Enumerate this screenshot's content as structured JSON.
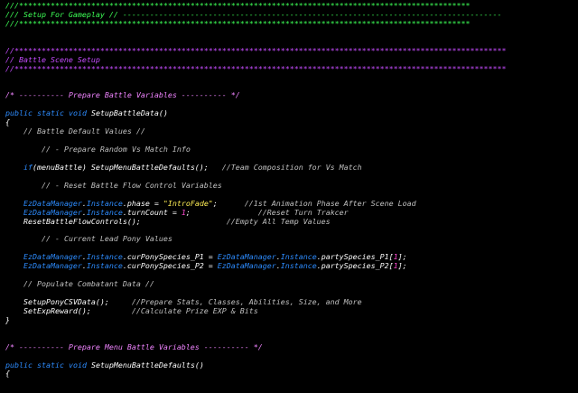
{
  "editor": {
    "colors": {
      "background": "#000000",
      "keyword": "#2d8cff",
      "comment": "#c0c0c0",
      "header_comment": "#3dff56",
      "section_comment": "#c64cff",
      "block_comment": "#f084ff",
      "string": "#ffee55",
      "number": "#ff4ad2",
      "text": "#ffffff"
    },
    "lines": [
      [
        {
          "t": "///****************************************************************************************************",
          "c": "gr"
        }
      ],
      [
        {
          "t": "/// Setup For Gameplay // ------------------------------------------------------------------------------------",
          "c": "gr"
        }
      ],
      [
        {
          "t": "///****************************************************************************************************",
          "c": "gr"
        }
      ],
      [],
      [],
      [
        {
          "t": "//*************************************************************************************************************",
          "c": "mg"
        }
      ],
      [
        {
          "t": "// Battle Scene Setup",
          "c": "mg"
        }
      ],
      [
        {
          "t": "//*************************************************************************************************************",
          "c": "mg"
        }
      ],
      [],
      [],
      [
        {
          "t": "/* ---------- Prepare Battle Variables ---------- */",
          "c": "pk"
        }
      ],
      [],
      [
        {
          "t": "public",
          "c": "kw"
        },
        {
          "t": " ",
          "c": "plain"
        },
        {
          "t": "static",
          "c": "kw"
        },
        {
          "t": " ",
          "c": "plain"
        },
        {
          "t": "void",
          "c": "kw"
        },
        {
          "t": " SetupBattleData()",
          "c": "plain"
        }
      ],
      [
        {
          "t": "{",
          "c": "plain"
        }
      ],
      [
        {
          "t": "    ",
          "c": "plain"
        },
        {
          "t": "// Battle Default Values //",
          "c": "cm"
        }
      ],
      [],
      [
        {
          "t": "        ",
          "c": "plain"
        },
        {
          "t": "// - Prepare Random Vs Match Info",
          "c": "cm"
        }
      ],
      [],
      [
        {
          "t": "    ",
          "c": "plain"
        },
        {
          "t": "if",
          "c": "kw"
        },
        {
          "t": "(menuBattle) SetupMenuBattleDefaults();   ",
          "c": "plain"
        },
        {
          "t": "//Team Composition for Vs Match",
          "c": "cm"
        }
      ],
      [],
      [
        {
          "t": "        ",
          "c": "plain"
        },
        {
          "t": "// - Reset Battle Flow Control Variables",
          "c": "cm"
        }
      ],
      [],
      [
        {
          "t": "    ",
          "c": "plain"
        },
        {
          "t": "EzDataManager",
          "c": "kw"
        },
        {
          "t": ".",
          "c": "plain"
        },
        {
          "t": "Instance",
          "c": "kw"
        },
        {
          "t": ".phase = ",
          "c": "plain"
        },
        {
          "t": "\"IntroFade\"",
          "c": "str"
        },
        {
          "t": ";      ",
          "c": "plain"
        },
        {
          "t": "//1st Animation Phase After Scene Load",
          "c": "cm"
        }
      ],
      [
        {
          "t": "    ",
          "c": "plain"
        },
        {
          "t": "EzDataManager",
          "c": "kw"
        },
        {
          "t": ".",
          "c": "plain"
        },
        {
          "t": "Instance",
          "c": "kw"
        },
        {
          "t": ".turnCount = ",
          "c": "plain"
        },
        {
          "t": "1",
          "c": "num"
        },
        {
          "t": ";               ",
          "c": "plain"
        },
        {
          "t": "//Reset Turn Trakcer",
          "c": "cm"
        }
      ],
      [
        {
          "t": "    ResetBattleFlowControls();                   ",
          "c": "plain"
        },
        {
          "t": "//Empty All Temp Values",
          "c": "cm"
        }
      ],
      [],
      [
        {
          "t": "        ",
          "c": "plain"
        },
        {
          "t": "// - Current Lead Pony Values",
          "c": "cm"
        }
      ],
      [],
      [
        {
          "t": "    ",
          "c": "plain"
        },
        {
          "t": "EzDataManager",
          "c": "kw"
        },
        {
          "t": ".",
          "c": "plain"
        },
        {
          "t": "Instance",
          "c": "kw"
        },
        {
          "t": ".curPonySpecies_P1 = ",
          "c": "plain"
        },
        {
          "t": "EzDataManager",
          "c": "kw"
        },
        {
          "t": ".",
          "c": "plain"
        },
        {
          "t": "Instance",
          "c": "kw"
        },
        {
          "t": ".partySpecies_P1[",
          "c": "plain"
        },
        {
          "t": "1",
          "c": "num"
        },
        {
          "t": "];",
          "c": "plain"
        }
      ],
      [
        {
          "t": "    ",
          "c": "plain"
        },
        {
          "t": "EzDataManager",
          "c": "kw"
        },
        {
          "t": ".",
          "c": "plain"
        },
        {
          "t": "Instance",
          "c": "kw"
        },
        {
          "t": ".curPonySpecies_P2 = ",
          "c": "plain"
        },
        {
          "t": "EzDataManager",
          "c": "kw"
        },
        {
          "t": ".",
          "c": "plain"
        },
        {
          "t": "Instance",
          "c": "kw"
        },
        {
          "t": ".partySpecies_P2[",
          "c": "plain"
        },
        {
          "t": "1",
          "c": "num"
        },
        {
          "t": "];",
          "c": "plain"
        }
      ],
      [],
      [
        {
          "t": "    ",
          "c": "plain"
        },
        {
          "t": "// Populate Combatant Data //",
          "c": "cm"
        }
      ],
      [],
      [
        {
          "t": "    SetupPonyCSVData();     ",
          "c": "plain"
        },
        {
          "t": "//Prepare Stats, Classes, Abilities, Size, and More",
          "c": "cm"
        }
      ],
      [
        {
          "t": "    SetExpReward();         ",
          "c": "plain"
        },
        {
          "t": "//Calculate Prize EXP & Bits",
          "c": "cm"
        }
      ],
      [
        {
          "t": "}",
          "c": "plain"
        }
      ],
      [],
      [],
      [
        {
          "t": "/* ---------- Prepare Menu Battle Variables ---------- */",
          "c": "pk"
        }
      ],
      [],
      [
        {
          "t": "public",
          "c": "kw"
        },
        {
          "t": " ",
          "c": "plain"
        },
        {
          "t": "static",
          "c": "kw"
        },
        {
          "t": " ",
          "c": "plain"
        },
        {
          "t": "void",
          "c": "kw"
        },
        {
          "t": " SetupMenuBattleDefaults()",
          "c": "plain"
        }
      ],
      [
        {
          "t": "{",
          "c": "plain"
        }
      ]
    ]
  }
}
